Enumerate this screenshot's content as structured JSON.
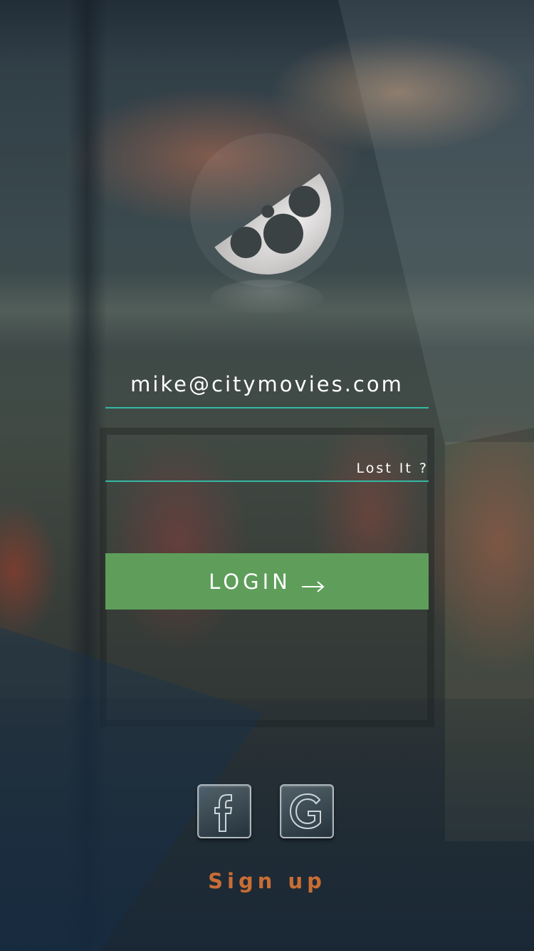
{
  "app": {
    "background": "blurred cinema storefront photo"
  },
  "login_form": {
    "email_value": "mike@citymovies.com",
    "password_value": "",
    "lost_link_label": "Lost It ?",
    "login_button_label": "LOGIN"
  },
  "social": {
    "facebook_icon": "facebook-icon",
    "google_icon": "google-icon"
  },
  "signup": {
    "label": "Sign up"
  },
  "colors": {
    "accent_underline": "#35b7a4",
    "login_button": "#5e9e5a",
    "signup_text": "#c96d35",
    "text": "#ffffff"
  }
}
